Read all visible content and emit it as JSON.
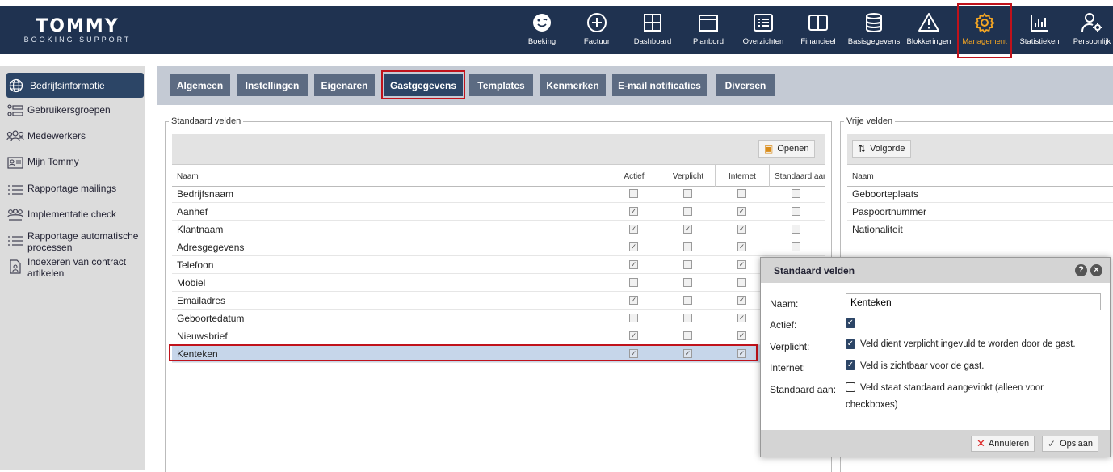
{
  "brand": {
    "title": "TOMMY",
    "subtitle": "BOOKING SUPPORT"
  },
  "nav": [
    {
      "label": "Boeking",
      "icon": "smiley-icon"
    },
    {
      "label": "Factuur",
      "icon": "plus-circle-icon"
    },
    {
      "label": "Dashboard",
      "icon": "dashboard-grid-icon"
    },
    {
      "label": "Planbord",
      "icon": "window-icon"
    },
    {
      "label": "Overzichten",
      "icon": "list-box-icon"
    },
    {
      "label": "Financieel",
      "icon": "book-icon"
    },
    {
      "label": "Basisgegevens",
      "icon": "database-icon"
    },
    {
      "label": "Blokkeringen",
      "icon": "warning-icon"
    },
    {
      "label": "Management",
      "icon": "gear-icon"
    },
    {
      "label": "Statistieken",
      "icon": "bar-chart-icon"
    },
    {
      "label": "Persoonlijk",
      "icon": "user-settings-icon"
    }
  ],
  "sidebar": [
    {
      "label": "Bedrijfsinformatie",
      "icon": "globe-icon"
    },
    {
      "label": "Gebruikersgroepen",
      "icon": "user-groups-icon"
    },
    {
      "label": "Medewerkers",
      "icon": "people-icon"
    },
    {
      "label": "Mijn Tommy",
      "icon": "id-card-icon"
    },
    {
      "label": "Rapportage mailings",
      "icon": "list-icon"
    },
    {
      "label": "Implementatie check",
      "icon": "team-icon"
    },
    {
      "label": "Rapportage automatische processen",
      "icon": "list-icon"
    },
    {
      "label": "Indexeren van contract artikelen",
      "icon": "contract-icon"
    }
  ],
  "tabs": [
    "Algemeen",
    "Instellingen",
    "Eigenaren",
    "Gastgegevens",
    "Templates",
    "Kenmerken",
    "E-mail notificaties",
    "Diversen"
  ],
  "standard_fields": {
    "legend": "Standaard velden",
    "open_button": "Openen",
    "columns": [
      "Naam",
      "Actief",
      "Verplicht",
      "Internet",
      "Standaard aan"
    ],
    "rows": [
      {
        "name": "Bedrijfsnaam",
        "actief": false,
        "verplicht": false,
        "internet": false,
        "standaard": false
      },
      {
        "name": "Aanhef",
        "actief": true,
        "verplicht": false,
        "internet": true,
        "standaard": false
      },
      {
        "name": "Klantnaam",
        "actief": true,
        "verplicht": true,
        "internet": true,
        "standaard": false
      },
      {
        "name": "Adresgegevens",
        "actief": true,
        "verplicht": false,
        "internet": true,
        "standaard": false
      },
      {
        "name": "Telefoon",
        "actief": true,
        "verplicht": false,
        "internet": true,
        "standaard": false
      },
      {
        "name": "Mobiel",
        "actief": false,
        "verplicht": false,
        "internet": false,
        "standaard": false
      },
      {
        "name": "Emailadres",
        "actief": true,
        "verplicht": false,
        "internet": true,
        "standaard": false
      },
      {
        "name": "Geboortedatum",
        "actief": false,
        "verplicht": false,
        "internet": true,
        "standaard": false
      },
      {
        "name": "Nieuwsbrief",
        "actief": true,
        "verplicht": false,
        "internet": true,
        "standaard": false
      },
      {
        "name": "Kenteken",
        "actief": true,
        "verplicht": true,
        "internet": true,
        "standaard": false
      }
    ]
  },
  "free_fields": {
    "legend": "Vrije velden",
    "order_button": "Volgorde",
    "column": "Naam",
    "rows": [
      "Geboorteplaats",
      "Paspoortnummer",
      "Nationaliteit"
    ]
  },
  "dialog": {
    "title": "Standaard velden",
    "help": "?",
    "close": "×",
    "naam_label": "Naam:",
    "naam_value": "Kenteken",
    "actief_label": "Actief:",
    "verplicht_label": "Verplicht:",
    "verplicht_text": "Veld dient verplicht ingevuld te worden door de gast.",
    "internet_label": "Internet:",
    "internet_text": "Veld is zichtbaar voor de gast.",
    "standaard_label": "Standaard aan:",
    "standaard_text_1": "Veld staat standaard aangevinkt (alleen voor",
    "standaard_text_2": "checkboxes)",
    "cancel": "Annuleren",
    "save": "Opslaan"
  },
  "colors": {
    "header": "#1f3250",
    "accent": "#f5a623",
    "highlight": "#c0121b",
    "selected_row": "#c6d6ea"
  }
}
